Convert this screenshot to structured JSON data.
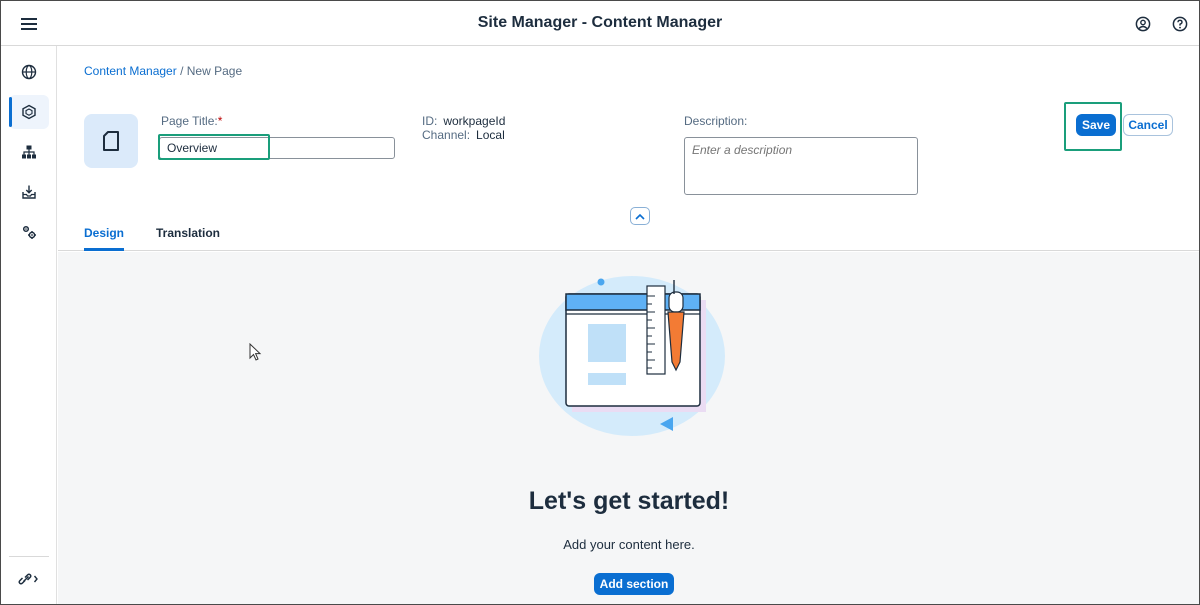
{
  "shell": {
    "title": "Site Manager - Content Manager",
    "menu_icon": "hamburger-menu-icon",
    "profile_icon": "user-profile-icon",
    "help_icon": "help-icon"
  },
  "sidenav": {
    "items": [
      {
        "icon": "globe-icon",
        "active": false
      },
      {
        "icon": "content-cube-icon",
        "active": true
      },
      {
        "icon": "hierarchy-icon",
        "active": false
      },
      {
        "icon": "inbox-download-icon",
        "active": false
      },
      {
        "icon": "settings-gears-icon",
        "active": false
      }
    ],
    "footer_icon": "link-expand-icon"
  },
  "breadcrumb": {
    "link": "Content Manager",
    "separator": "/",
    "current": "New Page"
  },
  "page": {
    "icon": "page-document-icon",
    "title_label": "Page Title:",
    "title_required_mark": "*",
    "title_value": "Overview",
    "id_label": "ID:",
    "id_value": "workpageId",
    "channel_label": "Channel:",
    "channel_value": "Local",
    "description_label": "Description:",
    "description_placeholder": "Enter a description",
    "description_value": ""
  },
  "actions": {
    "save_label": "Save",
    "cancel_label": "Cancel"
  },
  "tabs": [
    {
      "label": "Design",
      "active": true
    },
    {
      "label": "Translation",
      "active": false
    }
  ],
  "empty_state": {
    "heading": "Let's get started!",
    "subtext": "Add your content here.",
    "button_label": "Add section",
    "illustration": "design-board-ruler-pen-illustration"
  },
  "colors": {
    "accent": "#0a6ed1",
    "highlight_box": "#1a9e7b",
    "required": "#bb0000",
    "content_bg": "#f5f6f7"
  }
}
